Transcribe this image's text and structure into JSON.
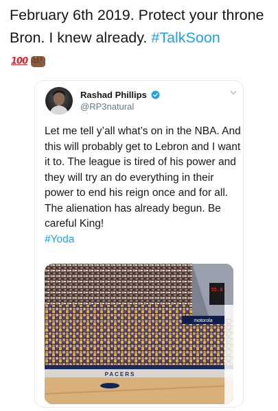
{
  "post": {
    "text": "February 6th 2019. Protect your throne Bron. I knew already.",
    "hashtag": "#TalkSoon",
    "emoji_100": "100",
    "emoji_fist": "fist-bump"
  },
  "quoted_tweet": {
    "author_name": "Rashad Phillips",
    "author_handle": "@RP3natural",
    "text": "Let me tell y’all what’s on in the NBA. And this will probably get to Lebron and I want it to. The league is tired of his power and they will try an do everything in their power to end his reign once and for all. The alienation has already begun. Be careful King!",
    "hashtag": "#Yoda",
    "photo": {
      "shot_clock": "55.8",
      "sponsor": "motorola",
      "court_text": "PACERS"
    }
  },
  "colors": {
    "link": "#1da1f2",
    "text": "#14171a",
    "secondary": "#657786",
    "border": "#e1e8ed"
  }
}
